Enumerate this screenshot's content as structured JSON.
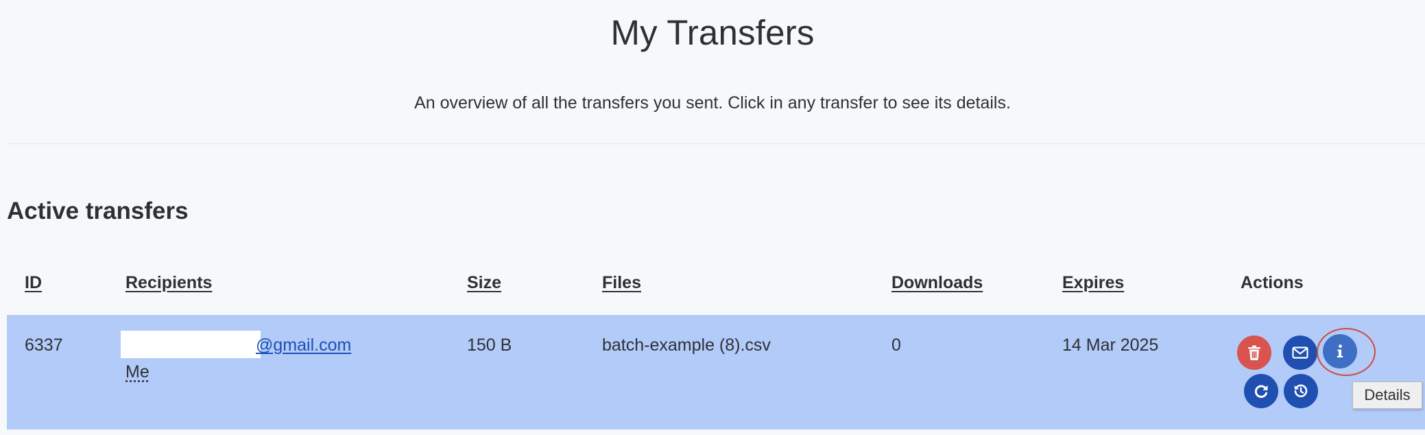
{
  "page": {
    "title": "My Transfers",
    "subtitle": "An overview of all the transfers you sent. Click in any transfer to see its details."
  },
  "section": {
    "title": "Active transfers"
  },
  "table": {
    "headers": {
      "id": "ID",
      "recipients": "Recipients",
      "size": "Size",
      "files": "Files",
      "downloads": "Downloads",
      "expires": "Expires",
      "actions": "Actions"
    },
    "rows": [
      {
        "id": "6337",
        "recipient_email": "@gmail.com",
        "recipient_me": "Me",
        "size": "150 B",
        "files": "batch-example (8).csv",
        "downloads": "0",
        "expires": "14 Mar 2025"
      }
    ]
  },
  "actions": {
    "delete_icon": "trash-icon",
    "email_icon": "envelope-icon",
    "details_icon": "info-icon",
    "reopen_icon": "refresh-icon",
    "extend_icon": "history-icon",
    "tooltip": "Details"
  },
  "colors": {
    "row_highlight": "#b2cbf9",
    "delete": "#d9534f",
    "primary": "#1f4fb0",
    "annotation_ring": "#d04a3c"
  }
}
